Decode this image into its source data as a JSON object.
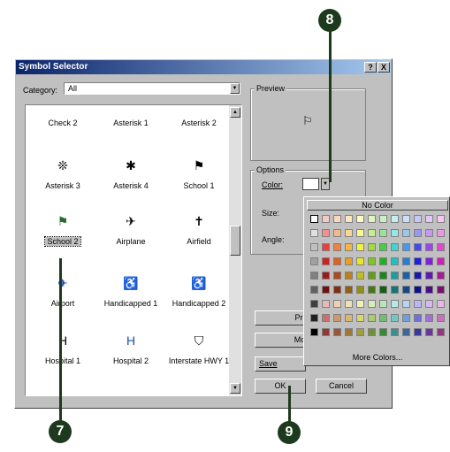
{
  "window": {
    "title": "Symbol Selector",
    "help_btn": "?",
    "close_btn": "X"
  },
  "category": {
    "label": "Category:",
    "value": "All"
  },
  "symbols": [
    {
      "label": "Check 2",
      "glyph": ""
    },
    {
      "label": "Asterisk 1",
      "glyph": ""
    },
    {
      "label": "Asterisk 2",
      "glyph": ""
    },
    {
      "label": "Asterisk 3",
      "glyph": "❊"
    },
    {
      "label": "Asterisk 4",
      "glyph": "✱"
    },
    {
      "label": "School 1",
      "glyph": "⚑"
    },
    {
      "label": "School 2",
      "glyph": "⚑"
    },
    {
      "label": "Airplane",
      "glyph": "✈"
    },
    {
      "label": "Airfield",
      "glyph": "✝"
    },
    {
      "label": "Airport",
      "glyph": "✈"
    },
    {
      "label": "Handicapped 1",
      "glyph": "♿"
    },
    {
      "label": "Handicapped 2",
      "glyph": "♿"
    },
    {
      "label": "Hospital 1",
      "glyph": "H"
    },
    {
      "label": "Hospital 2",
      "glyph": "H"
    },
    {
      "label": "Interstate HWY 1",
      "glyph": "⛉"
    }
  ],
  "preview": {
    "label": "Preview",
    "glyph": "⚐"
  },
  "options": {
    "label": "Options",
    "color_label": "Color:",
    "size_label": "Size:",
    "angle_label": "Angle:"
  },
  "buttons": {
    "properties": "Prop",
    "more": "More",
    "save": "Save",
    "ok": "OK",
    "cancel": "Cancel"
  },
  "color_picker": {
    "no_color": "No Color",
    "more_colors": "More Colors...",
    "columns": [
      "#e0e0e0",
      "#c0a0a0",
      "#e0b0b0",
      "#e0c8a0",
      "#e0e0a0",
      "#c8e0a0",
      "#a0e0a0",
      "#a0e0e0",
      "#a0c8e0",
      "#a0a0e0",
      "#c0a0e0",
      "#e0a0e0"
    ],
    "rows": [
      [
        "#ffffff",
        "#f4c8c8",
        "#f8d8c0",
        "#fce8c0",
        "#fcfcc0",
        "#e0f4c0",
        "#c8f0c8",
        "#c0f0f0",
        "#c8e0f8",
        "#c8c8f8",
        "#e0c8f8",
        "#f4c8f0"
      ],
      [
        "#e0e0e0",
        "#f09090",
        "#f4b890",
        "#f8d890",
        "#f8f890",
        "#c8ec90",
        "#98e498",
        "#90e8e8",
        "#98c8f0",
        "#9898f0",
        "#c898f0",
        "#ec98e4"
      ],
      [
        "#c0c0c0",
        "#e84040",
        "#f08040",
        "#f4b840",
        "#f4f440",
        "#a0dc40",
        "#48cc48",
        "#40d4d4",
        "#4898e8",
        "#4848e8",
        "#9848e8",
        "#e048d0"
      ],
      [
        "#a0a0a0",
        "#d02020",
        "#e06020",
        "#e8a020",
        "#e8e820",
        "#80c820",
        "#20b020",
        "#20c0c0",
        "#2080d8",
        "#2020d8",
        "#8020d8",
        "#d020b8"
      ],
      [
        "#808080",
        "#a01818",
        "#b04818",
        "#c08018",
        "#c0c018",
        "#60a018",
        "#188818",
        "#18a0a0",
        "#1860b0",
        "#1818b0",
        "#6018b0",
        "#a81894"
      ],
      [
        "#606060",
        "#701010",
        "#803010",
        "#906010",
        "#909010",
        "#487810",
        "#106010",
        "#107878",
        "#104888",
        "#101088",
        "#481088",
        "#781070"
      ],
      [
        "#404040",
        "#e8b8b8",
        "#ecd0b8",
        "#f0e0b8",
        "#f0f0b8",
        "#d8ecb8",
        "#b8e4b8",
        "#b8e8e8",
        "#b8d4f0",
        "#b8b8f0",
        "#d4b8f0",
        "#e8b8e4"
      ],
      [
        "#202020",
        "#c87070",
        "#d09870",
        "#d8b870",
        "#d8d870",
        "#a8cc70",
        "#70c070",
        "#70c8c8",
        "#70a0d8",
        "#7070d8",
        "#a070d8",
        "#c870c0"
      ],
      [
        "#000000",
        "#903838",
        "#985838",
        "#a07838",
        "#a0a038",
        "#709038",
        "#388838",
        "#389090",
        "#386898",
        "#383898",
        "#683898",
        "#903884"
      ]
    ]
  },
  "callouts": {
    "seven": "7",
    "eight": "8",
    "nine": "9"
  },
  "accent": "#1e3a1e"
}
